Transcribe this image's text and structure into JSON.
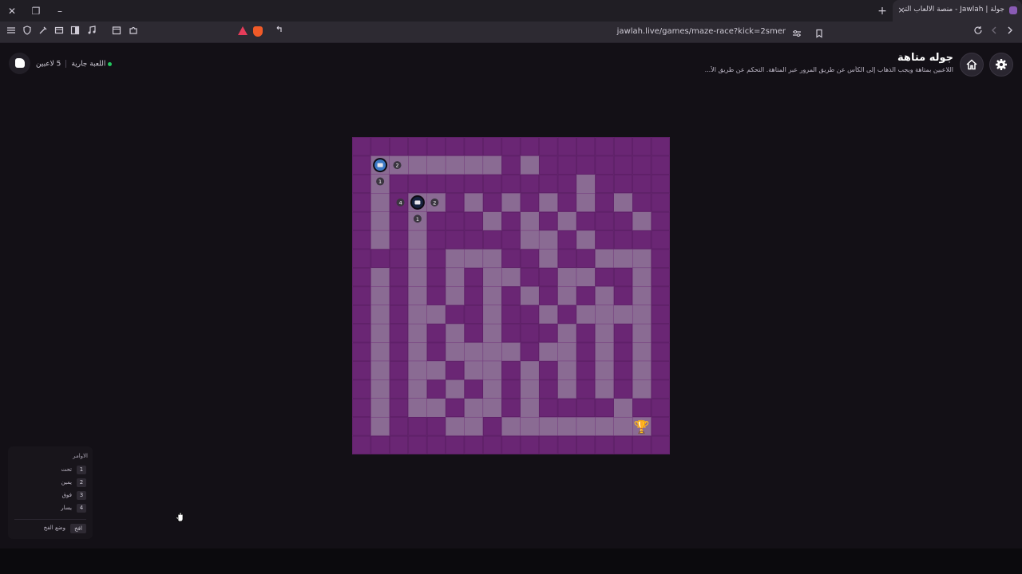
{
  "browser": {
    "tab_title": "جولة | Jawlah - منصة الألعاب التفا",
    "new_tab_icon": "+",
    "close_tab_icon": "×",
    "url": "jawlah.live/games/maze-race?kick=2smer",
    "window_close": "✕",
    "window_restore": "❐",
    "window_minimize": "–"
  },
  "header": {
    "title": "جوله متاهة",
    "description": "اللاعبين بمتاهة ويجب الذهاب إلى الكأس عن طريق المرور عبر المتاهة. التحكم عن طريق الأ...",
    "players": "5 لاعبين",
    "status": "اللعبة جارية"
  },
  "maze": {
    "cols": 17,
    "rows": 17,
    "wall_color": "#6a2674",
    "path_color": "#8a6b93",
    "open": [
      "00000000000000000",
      "01111111010000000",
      "01000000000010000",
      "01011010101010100",
      "01010001010100010",
      "01010000011010000",
      "00010111001001110",
      "01010101100110010",
      "01010101010101010",
      "01011001001011110",
      "01010101000101010",
      "01010111101101010",
      "01011011010101010",
      "01010101010101010",
      "01011011010000100",
      "01000110111111110",
      "00000000000000000"
    ],
    "players": [
      {
        "name": "player-1",
        "col": 1,
        "row": 1,
        "numbers": {
          "right": "2",
          "below": "1"
        },
        "color": "#3b78c4"
      },
      {
        "name": "player-2",
        "col": 3,
        "row": 3,
        "numbers": {
          "left": "4",
          "right": "2",
          "below": "1"
        },
        "color": "#17233f"
      }
    ],
    "trophy": {
      "col": 15,
      "row": 15,
      "glyph": "🏆"
    }
  },
  "commands": {
    "title": "الاوامر",
    "items": [
      {
        "key": "1",
        "label": "تحت"
      },
      {
        "key": "2",
        "label": "يمين"
      },
      {
        "key": "3",
        "label": "فوق"
      },
      {
        "key": "4",
        "label": "يسار"
      }
    ],
    "trap_key": "افخ",
    "trap_label": "وضع الفخ"
  }
}
